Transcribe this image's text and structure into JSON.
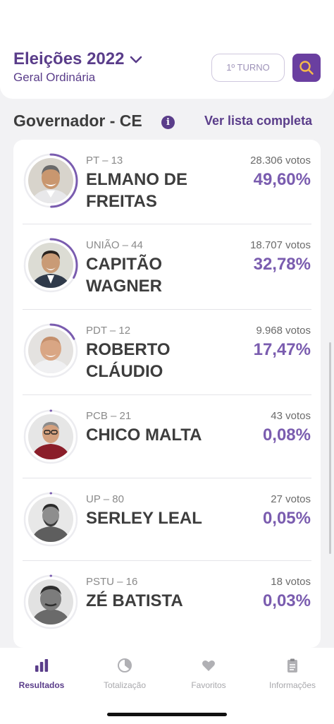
{
  "header": {
    "title": "Eleições 2022",
    "subtitle": "Geral Ordinária",
    "turno_label": "1º TURNO",
    "search_icon": "search-icon"
  },
  "section": {
    "title": "Governador - CE",
    "info_label": "i",
    "link_label": "Ver lista completa"
  },
  "candidates": [
    {
      "party": "PT – 13",
      "name": "ELMANO DE FREITAS",
      "votes": "28.306 votos",
      "percent": "49,60%",
      "share": 49.6
    },
    {
      "party": "UNIÃO – 44",
      "name": "CAPITÃO WAGNER",
      "votes": "18.707 votos",
      "percent": "32,78%",
      "share": 32.78
    },
    {
      "party": "PDT – 12",
      "name": "ROBERTO CLÁUDIO",
      "votes": "9.968 votos",
      "percent": "17,47%",
      "share": 17.47
    },
    {
      "party": "PCB – 21",
      "name": "CHICO MALTA",
      "votes": "43 votos",
      "percent": "0,08%",
      "share": 0.08
    },
    {
      "party": "UP – 80",
      "name": "SERLEY LEAL",
      "votes": "27 votos",
      "percent": "0,05%",
      "share": 0.05
    },
    {
      "party": "PSTU – 16",
      "name": "ZÉ BATISTA",
      "votes": "18 votos",
      "percent": "0,03%",
      "share": 0.03
    }
  ],
  "tabs": [
    {
      "label": "Resultados",
      "icon": "bar-chart-icon",
      "active": true
    },
    {
      "label": "Totalização",
      "icon": "pie-chart-icon",
      "active": false
    },
    {
      "label": "Favoritos",
      "icon": "heart-icon",
      "active": false
    },
    {
      "label": "Informações",
      "icon": "clipboard-icon",
      "active": false
    }
  ],
  "colors": {
    "accent": "#5a3d8a",
    "percent": "#7a5caf",
    "ring": "#7a5caf"
  }
}
